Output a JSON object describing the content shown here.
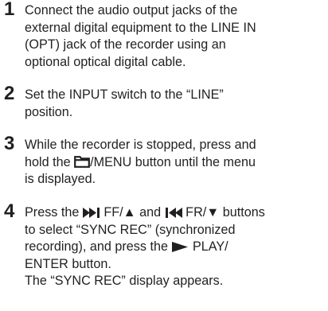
{
  "steps": [
    {
      "number": "1",
      "lines": [
        "Connect the audio output jacks of the",
        "external digital equipment to the LINE IN",
        "(OPT) jack of the recorder using an",
        "optional optical digital cable."
      ]
    },
    {
      "number": "2",
      "lines": [
        "Set the INPUT switch to the “LINE”",
        "position."
      ]
    },
    {
      "number": "3",
      "line1": "While the recorder is stopped, press and",
      "line2_pre": "hold the ",
      "line2_post": "/MENU button until the menu",
      "line3": "is displayed."
    },
    {
      "number": "4",
      "line1_pre": "Press the ",
      "line1_mid": " FF/▲ and ",
      "line1_post": " FR/▼ buttons",
      "line2": "to select “SYNC REC” (synchronized",
      "line3_pre": "recording), and press the ",
      "line3_post": " PLAY/",
      "line4": "ENTER button.",
      "line5": "The “SYNC REC” display appears."
    }
  ],
  "icons": {
    "folder": "folder-icon",
    "skip_forward": "skip-forward-icon",
    "skip_back": "skip-back-icon",
    "play": "play-icon"
  }
}
